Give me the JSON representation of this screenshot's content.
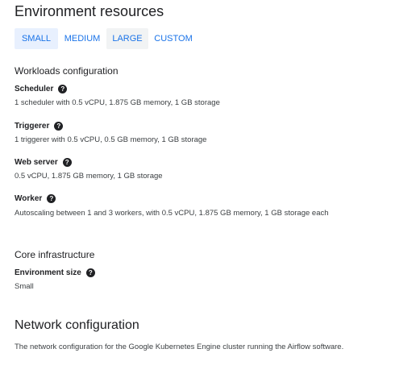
{
  "page_title": "Environment resources",
  "size_tabs": [
    {
      "label": "SMALL",
      "selected": true
    },
    {
      "label": "MEDIUM",
      "selected": false
    },
    {
      "label": "LARGE",
      "selected": false
    },
    {
      "label": "CUSTOM",
      "selected": false
    }
  ],
  "workloads": {
    "title": "Workloads configuration",
    "scheduler": {
      "label": "Scheduler",
      "desc": "1 scheduler with 0.5 vCPU, 1.875 GB memory, 1 GB storage"
    },
    "triggerer": {
      "label": "Triggerer",
      "desc": "1 triggerer with 0.5 vCPU, 0.5 GB memory, 1 GB storage"
    },
    "web_server": {
      "label": "Web server",
      "desc": "0.5 vCPU, 1.875 GB memory, 1 GB storage"
    },
    "worker": {
      "label": "Worker",
      "desc": "Autoscaling between 1 and 3 workers, with 0.5 vCPU, 1.875 GB memory, 1 GB storage each"
    }
  },
  "core": {
    "title": "Core infrastructure",
    "environment_size": {
      "label": "Environment size",
      "value": "Small"
    }
  },
  "network": {
    "title": "Network configuration",
    "desc": "The network configuration for the Google Kubernetes Engine cluster running the Airflow software."
  },
  "help_glyph": "?",
  "colors": {
    "accent": "#1a73e8",
    "selected_bg": "#e8f0fe",
    "hover_bg": "#f1f3f4",
    "text": "#202124"
  }
}
